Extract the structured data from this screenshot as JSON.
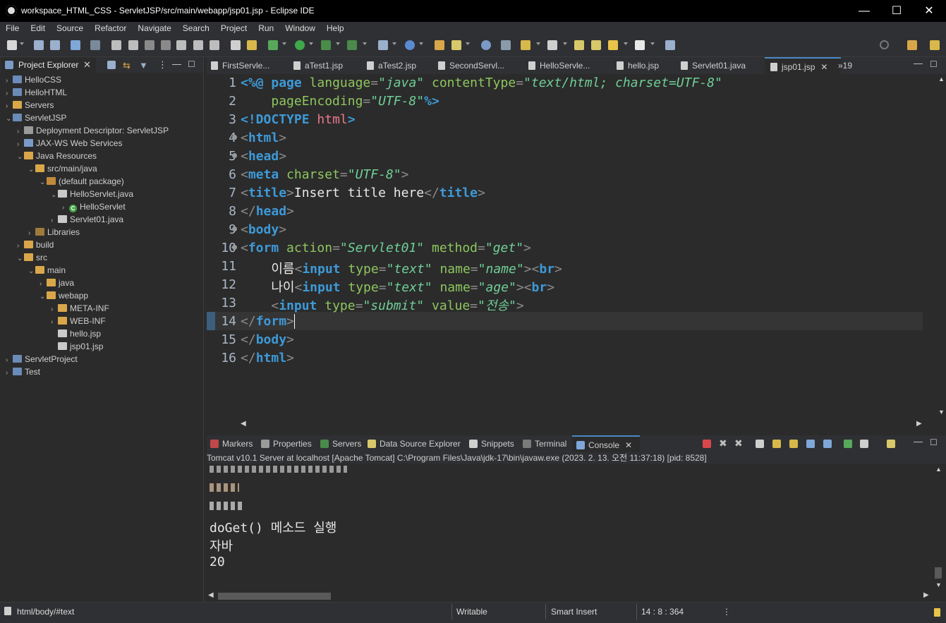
{
  "window": {
    "title": "workspace_HTML_CSS - ServletJSP/src/main/webapp/jsp01.jsp - Eclipse IDE",
    "minimize": "—",
    "maximize": "☐",
    "close": "✕"
  },
  "menu": [
    "File",
    "Edit",
    "Source",
    "Refactor",
    "Navigate",
    "Search",
    "Project",
    "Run",
    "Window",
    "Help"
  ],
  "project_explorer": {
    "title": "Project Explorer",
    "items": [
      {
        "label": "HelloCSS",
        "icon": "project-icon"
      },
      {
        "label": "HelloHTML",
        "icon": "project-icon"
      },
      {
        "label": "Servers",
        "icon": "folder-icon"
      },
      {
        "label": "ServletJSP",
        "icon": "project-icon"
      },
      {
        "label": "Deployment Descriptor: ServletJSP",
        "icon": "descriptor-icon"
      },
      {
        "label": "JAX-WS Web Services",
        "icon": "webservice-icon"
      },
      {
        "label": "Java Resources",
        "icon": "java-resources-icon"
      },
      {
        "label": "src/main/java",
        "icon": "source-folder-icon"
      },
      {
        "label": "(default package)",
        "icon": "package-icon"
      },
      {
        "label": "HelloServlet.java",
        "icon": "java-file-icon"
      },
      {
        "label": "HelloServlet",
        "icon": "class-icon"
      },
      {
        "label": "Servlet01.java",
        "icon": "java-file-icon"
      },
      {
        "label": "Libraries",
        "icon": "library-icon"
      },
      {
        "label": "build",
        "icon": "folder-icon"
      },
      {
        "label": "src",
        "icon": "folder-icon"
      },
      {
        "label": "main",
        "icon": "folder-icon"
      },
      {
        "label": "java",
        "icon": "folder-icon"
      },
      {
        "label": "webapp",
        "icon": "folder-icon"
      },
      {
        "label": "META-INF",
        "icon": "folder-icon"
      },
      {
        "label": "WEB-INF",
        "icon": "folder-icon"
      },
      {
        "label": "hello.jsp",
        "icon": "jsp-file-icon"
      },
      {
        "label": "jsp01.jsp",
        "icon": "jsp-file-icon"
      },
      {
        "label": "ServletProject",
        "icon": "project-icon"
      },
      {
        "label": "Test",
        "icon": "project-icon"
      }
    ]
  },
  "editor_tabs": {
    "tabs": [
      "FirstServle...",
      "aTest1.jsp",
      "aTest2.jsp",
      "SecondServl...",
      "HelloServle...",
      "hello.jsp",
      "Servlet01.java",
      "jsp01.jsp"
    ],
    "overflow": "»19"
  },
  "editor": {
    "line_numbers": [
      "1",
      "2",
      "3",
      "4",
      "5",
      "6",
      "7",
      "8",
      "9",
      "10",
      "11",
      "12",
      "13",
      "14",
      "15",
      "16"
    ]
  },
  "bottom_tabs": [
    "Markers",
    "Properties",
    "Servers",
    "Data Source Explorer",
    "Snippets",
    "Terminal",
    "Console"
  ],
  "console": {
    "description": "Tomcat v10.1 Server at localhost [Apache Tomcat] C:\\Program Files\\Java\\jdk-17\\bin\\javaw.exe  (2023. 2. 13. 오전 11:37:18) [pid: 8528]",
    "lines": [
      "doGet() 메소드 실행",
      "자바",
      "20"
    ]
  },
  "status": {
    "path": "html/body/#text",
    "writable": "Writable",
    "insert_mode": "Smart Insert",
    "position": "14 : 8 : 364"
  }
}
